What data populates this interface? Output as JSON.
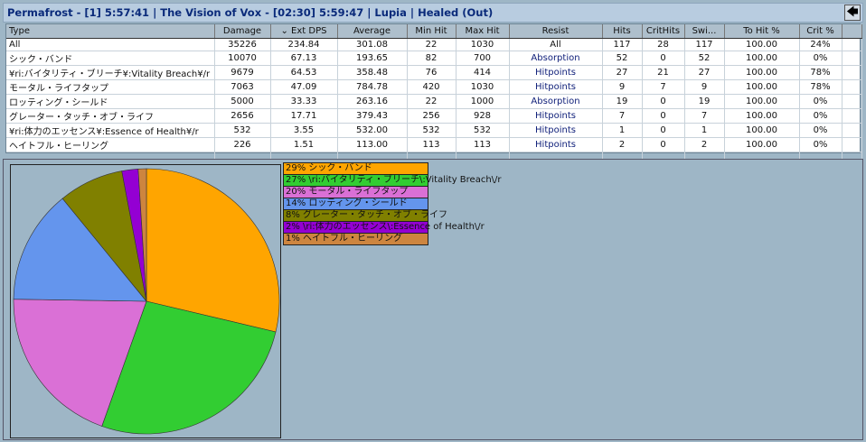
{
  "title": "Permafrost - [1] 5:57:41  |  The Vision of Vox - [02:30] 5:59:47  |  Lupia  |  Healed (Out)",
  "back_icon": "arrow-left-icon",
  "columns": [
    "Type",
    "Damage",
    "⌄  Ext DPS",
    "Average",
    "Min Hit",
    "Max Hit",
    "Resist",
    "Hits",
    "CritHits",
    "Swi...",
    "To Hit %",
    "Crit %",
    ""
  ],
  "rows": [
    [
      "All",
      "35226",
      "234.84",
      "301.08",
      "22",
      "1030",
      "All",
      "117",
      "28",
      "117",
      "100.00",
      "24%"
    ],
    [
      "シック・バンド",
      "10070",
      "67.13",
      "193.65",
      "82",
      "700",
      "Absorption",
      "52",
      "0",
      "52",
      "100.00",
      "0%"
    ],
    [
      "¥ri:バイタリティ・ブリーチ¥:Vitality Breach¥/r",
      "9679",
      "64.53",
      "358.48",
      "76",
      "414",
      "Hitpoints",
      "27",
      "21",
      "27",
      "100.00",
      "78%"
    ],
    [
      "モータル・ライフタップ",
      "7063",
      "47.09",
      "784.78",
      "420",
      "1030",
      "Hitpoints",
      "9",
      "7",
      "9",
      "100.00",
      "78%"
    ],
    [
      "ロッティング・シールド",
      "5000",
      "33.33",
      "263.16",
      "22",
      "1000",
      "Absorption",
      "19",
      "0",
      "19",
      "100.00",
      "0%"
    ],
    [
      "グレーター・タッチ・オブ・ライフ",
      "2656",
      "17.71",
      "379.43",
      "256",
      "928",
      "Hitpoints",
      "7",
      "0",
      "7",
      "100.00",
      "0%"
    ],
    [
      "¥ri:体力のエッセンス¥:Essence of Health¥/r",
      "532",
      "3.55",
      "532.00",
      "532",
      "532",
      "Hitpoints",
      "1",
      "0",
      "1",
      "100.00",
      "0%"
    ],
    [
      "ヘイトフル・ヒーリング",
      "226",
      "1.51",
      "113.00",
      "113",
      "113",
      "Hitpoints",
      "2",
      "0",
      "2",
      "100.00",
      "0%"
    ]
  ],
  "chart_data": {
    "type": "pie",
    "start": "top",
    "direction": "clockwise",
    "slices": [
      {
        "label": "29%  シック・バンド",
        "value": 29,
        "color": "#ffa500"
      },
      {
        "label": "27%  \\ri:バイタリティ・ブリーチ\\:Vitality Breach\\/r",
        "value": 27,
        "color": "#32cd32"
      },
      {
        "label": "20%  モータル・ライフタップ",
        "value": 20,
        "color": "#da70d6"
      },
      {
        "label": "14%  ロッティング・シールド",
        "value": 14,
        "color": "#6495ed"
      },
      {
        "label": "8%   グレーター・タッチ・オブ・ライフ",
        "value": 8,
        "color": "#808000"
      },
      {
        "label": "2%   \\ri:体力のエッセンス\\:Essence of Health\\/r",
        "value": 2,
        "color": "#9400d3"
      },
      {
        "label": "1%   ヘイトフル・ヒーリング",
        "value": 1,
        "color": "#cd853f"
      }
    ]
  }
}
